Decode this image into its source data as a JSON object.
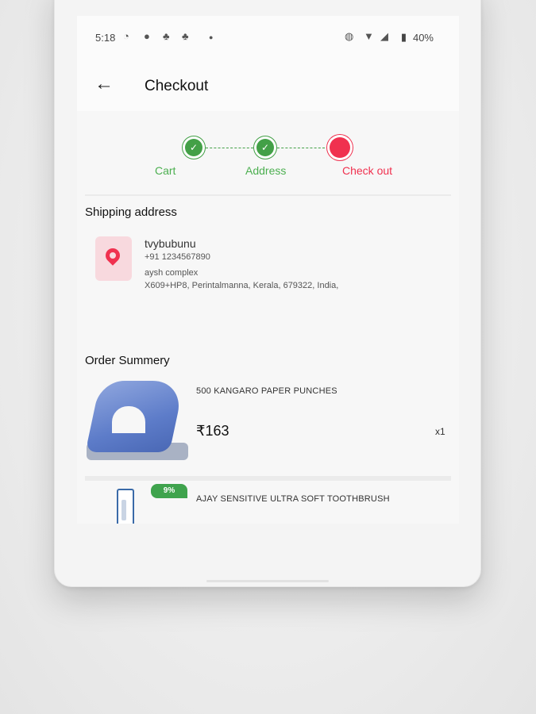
{
  "status_bar": {
    "time": "5:18",
    "battery": "40%",
    "icons_left": [
      "whatsapp-icon",
      "chat-icon",
      "snapchat-icon",
      "snapchat-icon",
      "dot-icon"
    ],
    "icons_right": [
      "vibrate-icon",
      "wifi-icon",
      "signal-icon",
      "battery-icon"
    ]
  },
  "app_bar": {
    "title": "Checkout",
    "back_icon": "arrow-left-icon"
  },
  "stepper": {
    "steps": [
      {
        "label": "Cart",
        "state": "done"
      },
      {
        "label": "Address",
        "state": "done"
      },
      {
        "label": "Check out",
        "state": "active"
      }
    ],
    "done_color": "#43a047",
    "active_color": "#f0314f"
  },
  "shipping": {
    "title": "Shipping address",
    "name": "tvybubunu",
    "phone": "+91 1234567890",
    "line1": "aysh complex",
    "line2": "X609+HP8,  Perintalmanna, Kerala, 679322, India,"
  },
  "order_summary": {
    "title": "Order Summery",
    "items": [
      {
        "name": "500 KANGARO PAPER PUNCHES",
        "price": "₹163",
        "qty": "x1"
      },
      {
        "name": "AJAY SENSITIVE ULTRA SOFT TOOTHBRUSH",
        "badge": "9%"
      }
    ]
  }
}
